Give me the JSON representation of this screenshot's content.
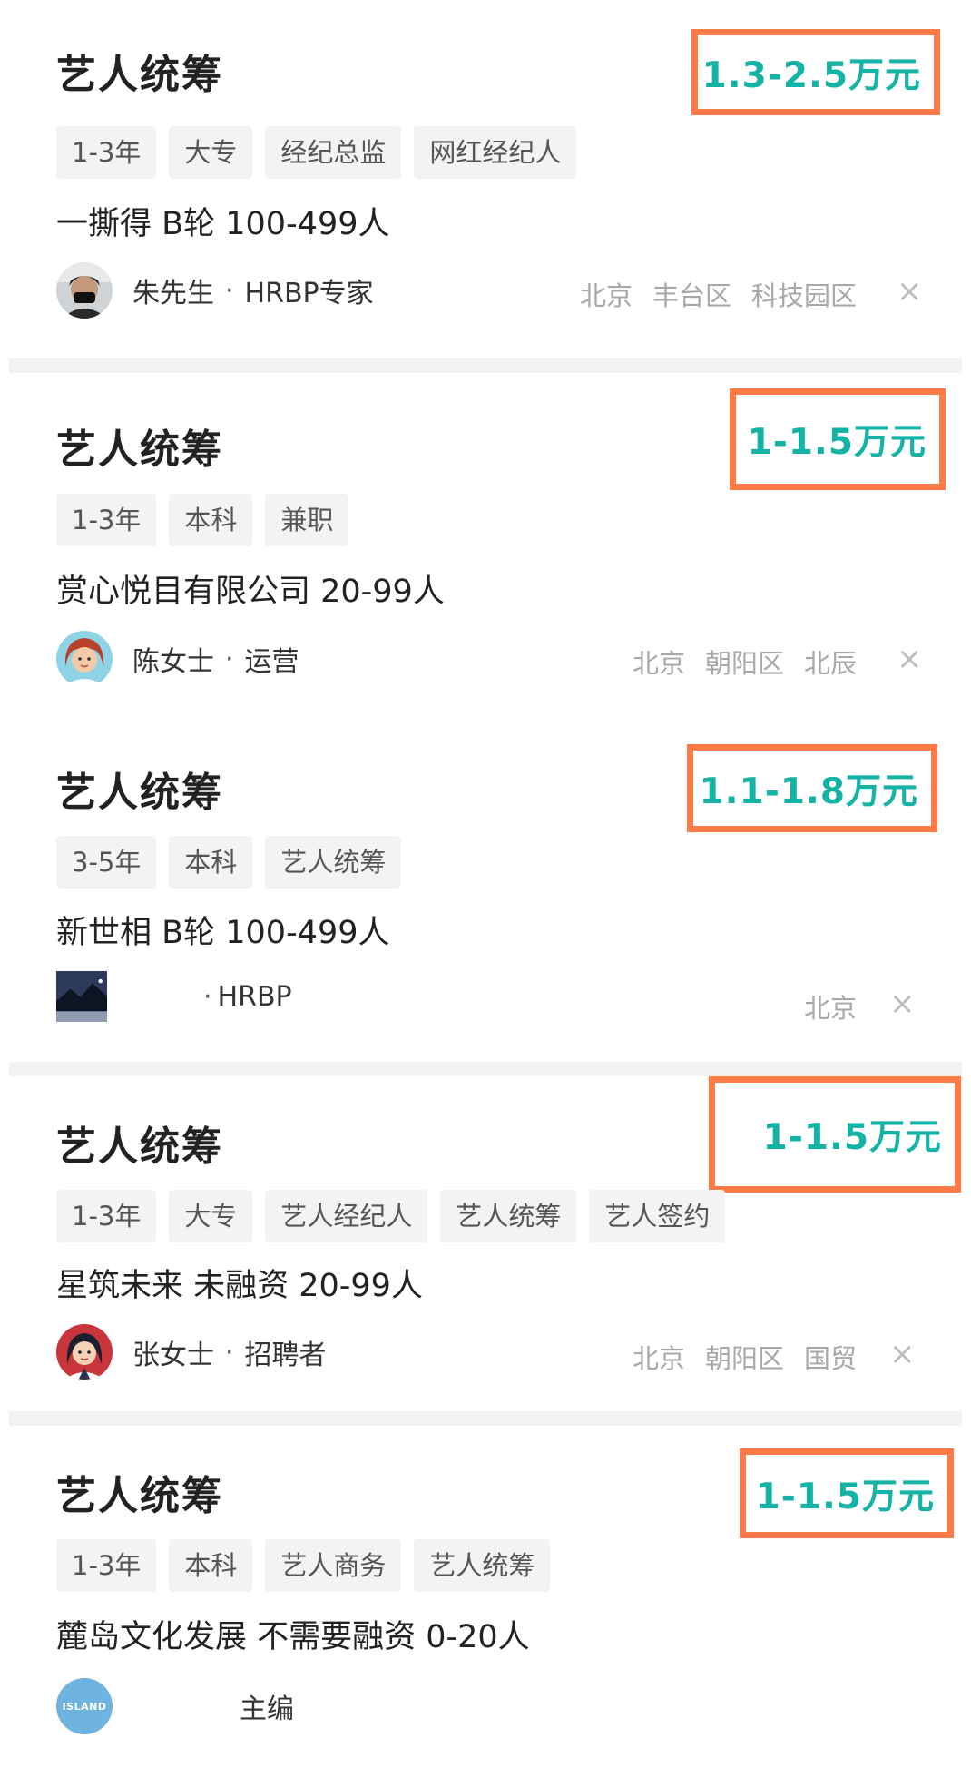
{
  "jobs": [
    {
      "title": "艺人统筹",
      "salary": "1.3-2.5万元",
      "tags": [
        "1-3年",
        "大专",
        "经纪总监",
        "网红经纪人"
      ],
      "company": "一撕得 B轮 100-499人",
      "recruiter_name": "朱先生",
      "recruiter_role": "HRBP专家",
      "location": [
        "北京",
        "丰台区",
        "科技园区"
      ],
      "close_label": "×"
    },
    {
      "title": "艺人统筹",
      "salary": "1-1.5万元",
      "tags": [
        "1-3年",
        "本科",
        "兼职"
      ],
      "company": "赏心悦目有限公司  20-99人",
      "recruiter_name": "陈女士",
      "recruiter_role": "运营",
      "location": [
        "北京",
        "朝阳区",
        "北辰"
      ],
      "close_label": "×"
    },
    {
      "title": "艺人统筹",
      "salary": "1.1-1.8万元",
      "tags": [
        "3-5年",
        "本科",
        "艺人统筹"
      ],
      "company": "新世相 B轮 100-499人",
      "recruiter_name": "",
      "recruiter_role": "HRBP",
      "location": [
        "北京"
      ],
      "close_label": "×"
    },
    {
      "title": "艺人统筹",
      "salary": "1-1.5万元",
      "tags": [
        "1-3年",
        "大专",
        "艺人经纪人",
        "艺人统筹",
        "艺人签约"
      ],
      "company": "星筑未来 未融资 20-99人",
      "recruiter_name": "张女士",
      "recruiter_role": "招聘者",
      "location": [
        "北京",
        "朝阳区",
        "国贸"
      ],
      "close_label": "×"
    },
    {
      "title": "艺人统筹",
      "salary": "1-1.5万元",
      "tags": [
        "1-3年",
        "本科",
        "艺人商务",
        "艺人统筹"
      ],
      "company": "麓岛文化发展 不需要融资 0-20人",
      "recruiter_name": "",
      "recruiter_role": "主编",
      "avatar_text": "ISLAND",
      "location": [],
      "close_label": ""
    }
  ],
  "colors": {
    "salary": "#15b3a6",
    "highlight_box": "#ff7a45"
  }
}
